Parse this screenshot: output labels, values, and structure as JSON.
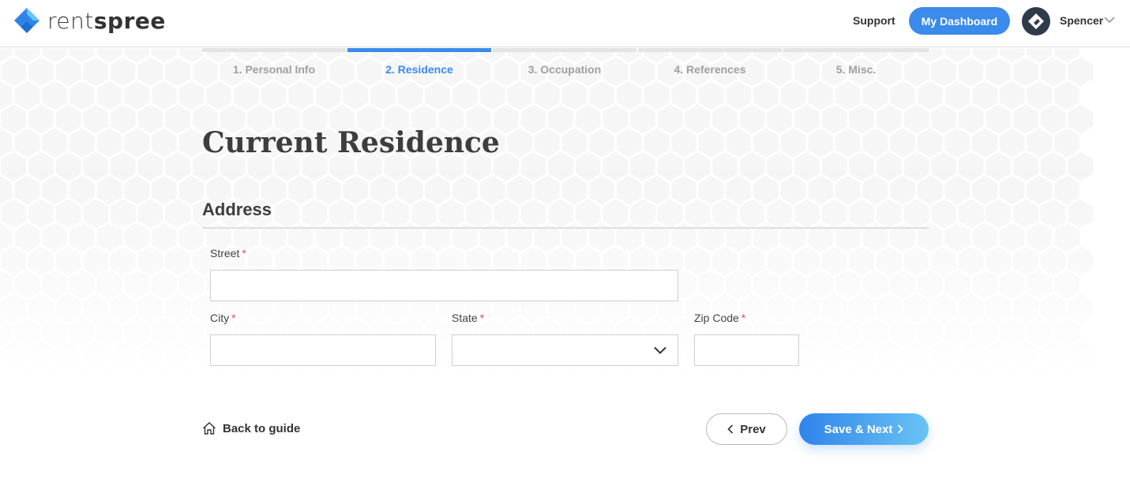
{
  "header": {
    "logo_text_light": "rent",
    "logo_text_bold": "spree",
    "support_label": "Support",
    "dashboard_label": "My Dashboard",
    "user_name": "Spencer",
    "brand_color": "#3b8bec"
  },
  "steps": [
    {
      "label": "1. Personal Info",
      "active": false
    },
    {
      "label": "2. Residence",
      "active": true
    },
    {
      "label": "3. Occupation",
      "active": false
    },
    {
      "label": "4. References",
      "active": false
    },
    {
      "label": "5. Misc.",
      "active": false
    }
  ],
  "page": {
    "title": "Current Residence",
    "section_title": "Address"
  },
  "form": {
    "street": {
      "label": "Street",
      "required_mark": "*",
      "value": ""
    },
    "city": {
      "label": "City",
      "required_mark": "*",
      "value": ""
    },
    "state": {
      "label": "State",
      "required_mark": "*",
      "value": ""
    },
    "zip": {
      "label": "Zip Code",
      "required_mark": "*",
      "value": ""
    }
  },
  "footer": {
    "back_label": "Back to guide",
    "prev_label": "Prev",
    "next_label": "Save & Next"
  }
}
